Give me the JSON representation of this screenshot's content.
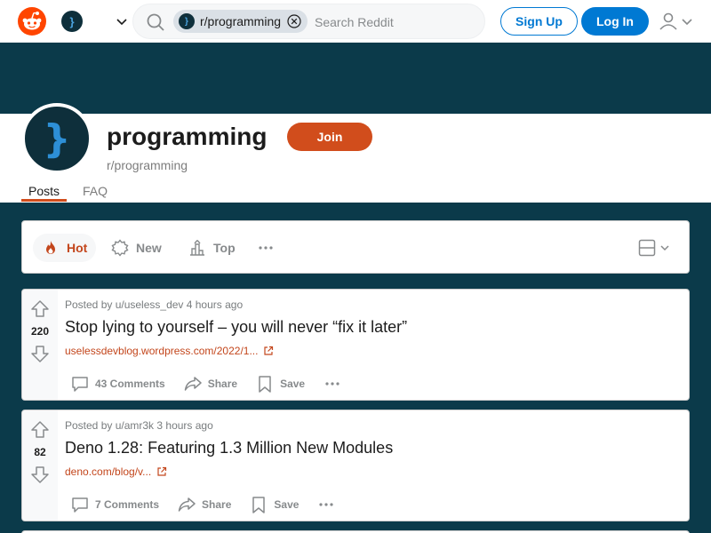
{
  "header": {
    "community_icon_glyph": "}",
    "search": {
      "chip_label": "r/programming",
      "placeholder": "Search Reddit"
    },
    "signup_label": "Sign Up",
    "login_label": "Log In"
  },
  "community": {
    "avatar_glyph": "}",
    "title": "programming",
    "subtitle": "r/programming",
    "join_label": "Join",
    "tabs": [
      {
        "label": "Posts",
        "active": true
      },
      {
        "label": "FAQ",
        "active": false
      }
    ]
  },
  "sort": {
    "items": [
      {
        "label": "Hot",
        "active": true
      },
      {
        "label": "New",
        "active": false
      },
      {
        "label": "Top",
        "active": false
      }
    ]
  },
  "posts": [
    {
      "votes": "220",
      "meta": "Posted by u/useless_dev 4 hours ago",
      "title": "Stop lying to yourself – you will never “fix it later”",
      "link": "uselessdevblog.wordpress.com/2022/1...",
      "comments_label": "43 Comments",
      "share_label": "Share",
      "save_label": "Save"
    },
    {
      "votes": "82",
      "meta": "Posted by u/amr3k 3 hours ago",
      "title": "Deno 1.28: Featuring 1.3 Million New Modules",
      "link": "deno.com/blog/v...",
      "comments_label": "7 Comments",
      "share_label": "Share",
      "save_label": "Save"
    }
  ],
  "colors": {
    "brand": "#ff4500",
    "accent_blue": "#0079d3",
    "join_orange": "#d14d1c",
    "banner": "#0b3a4a",
    "link": "#c3461c"
  }
}
